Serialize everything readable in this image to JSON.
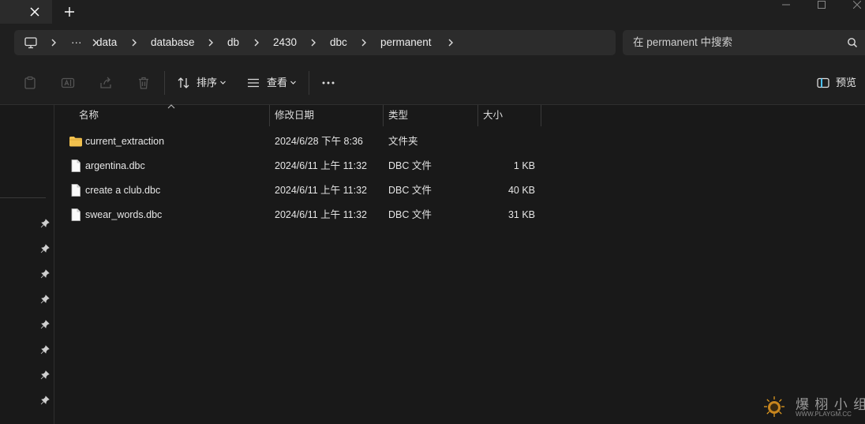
{
  "breadcrumb": {
    "more": "···",
    "items": [
      "data",
      "database",
      "db",
      "2430",
      "dbc",
      "permanent"
    ]
  },
  "search": {
    "placeholder": "在 permanent 中搜索"
  },
  "toolbar": {
    "sort_label": "排序",
    "view_label": "查看",
    "preview_label": "预览"
  },
  "columns": {
    "name": "名称",
    "date": "修改日期",
    "type": "类型",
    "size": "大小"
  },
  "files": [
    {
      "name": "current_extraction",
      "date": "2024/6/28 下午 8:36",
      "type": "文件夹",
      "size": "",
      "kind": "folder"
    },
    {
      "name": "argentina.dbc",
      "date": "2024/6/11 上午 11:32",
      "type": "DBC 文件",
      "size": "1 KB",
      "kind": "file"
    },
    {
      "name": "create a club.dbc",
      "date": "2024/6/11 上午 11:32",
      "type": "DBC 文件",
      "size": "40 KB",
      "kind": "file"
    },
    {
      "name": "swear_words.dbc",
      "date": "2024/6/11 上午 11:32",
      "type": "DBC 文件",
      "size": "31 KB",
      "kind": "file"
    }
  ],
  "watermark": {
    "brand": "爆 栩 小 组",
    "url": "WWW.PLAYGM.CC"
  },
  "colors": {
    "folder": "#f2c14e",
    "accent": "#4cc2ff"
  }
}
